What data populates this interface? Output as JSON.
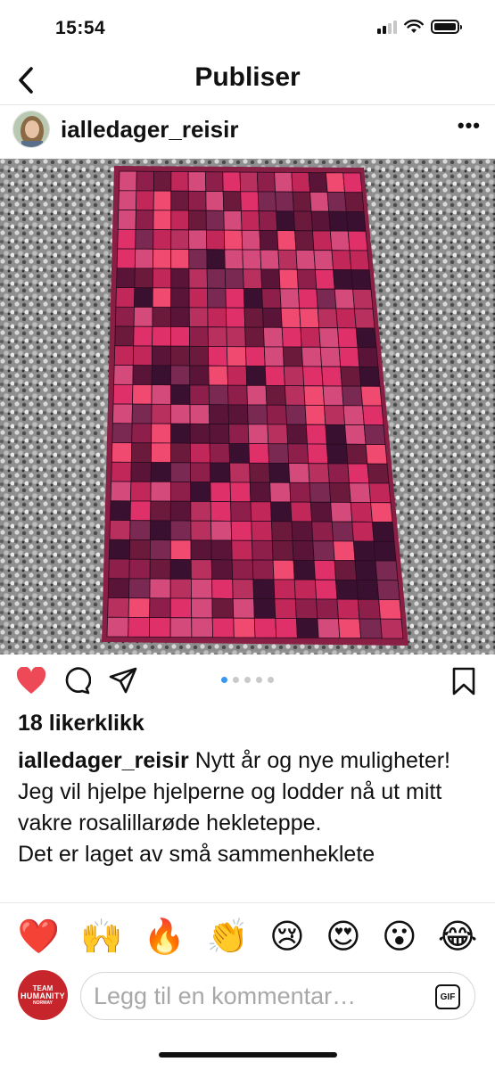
{
  "status_bar": {
    "time": "15:54",
    "icons": [
      "cellular-signal-icon",
      "wifi-icon",
      "battery-icon"
    ]
  },
  "nav": {
    "back_icon": "chevron-left-icon",
    "title": "Publiser"
  },
  "post": {
    "username": "ialledager_reisir",
    "more_icon": "more-horizontal-icon",
    "more_label": "•••",
    "image_icon": "crochet-blanket-photo",
    "carousel": {
      "total": 5,
      "active_index": 1
    },
    "actions": [
      "heart-filled-icon",
      "comment-icon",
      "share-icon",
      "bookmark-icon"
    ],
    "likes_text": "18 likerklikk",
    "caption": {
      "user": "ialledager_reisir",
      "text": "Nytt år og nye muligheter!",
      "line2": "Jeg vil hjelpe hjelperne og lodder nå ut mitt vakre rosalillarøde hekleteppe.",
      "line3": "Det er laget av små sammenheklete"
    }
  },
  "emoji_bar": [
    "❤️",
    "🙌",
    "🔥",
    "👏",
    "😢",
    "😍",
    "😮",
    "😂"
  ],
  "comment": {
    "avatar_line1": "TEAM",
    "avatar_line2": "HUMANITY",
    "avatar_line3": "NORWAY",
    "placeholder": "Legg til en kommentar…",
    "gif_label": "GIF"
  },
  "colors": {
    "like_red": "#ed4956",
    "carousel_active": "#3897f0",
    "team_red": "#c6262b"
  }
}
